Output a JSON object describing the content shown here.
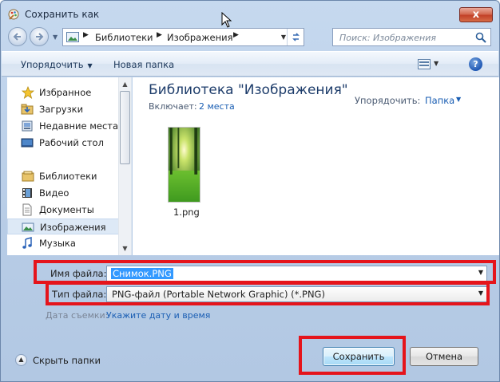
{
  "window": {
    "title": "Сохранить как",
    "close_glyph": "x"
  },
  "address": {
    "crumbs": [
      "Библиотеки",
      "Изображения"
    ],
    "search_placeholder": "Поиск: Изображения"
  },
  "toolbar": {
    "organize_label": "Упорядочить",
    "new_folder_label": "Новая папка",
    "help_glyph": "?"
  },
  "sidebar": {
    "items": [
      {
        "label": "Избранное",
        "icon": "star-icon"
      },
      {
        "label": "Загрузки",
        "icon": "downloads-icon"
      },
      {
        "label": "Недавние места",
        "icon": "recent-places-icon"
      },
      {
        "label": "Рабочий стол",
        "icon": "desktop-icon"
      },
      {
        "label": "Библиотеки",
        "icon": "libraries-icon"
      },
      {
        "label": "Видео",
        "icon": "video-icon"
      },
      {
        "label": "Документы",
        "icon": "documents-icon"
      },
      {
        "label": "Изображения",
        "icon": "pictures-icon",
        "selected": true
      },
      {
        "label": "Музыка",
        "icon": "music-icon"
      }
    ]
  },
  "content": {
    "library_title": "Библиотека \"Изображения\"",
    "includes_label": "Включает:",
    "includes_link": "2 места",
    "arrange_label": "Упорядочить:",
    "arrange_value": "Папка",
    "files": [
      {
        "name": "1.png"
      }
    ]
  },
  "form": {
    "filename_label": "Имя файла:",
    "filename_value": "Снимок.PNG",
    "filetype_label": "Тип файла:",
    "filetype_value": "PNG-файл (Portable Network Graphic) (*.PNG)",
    "date_label": "Дата съемки:",
    "date_link": "Укажите дату и время"
  },
  "footer": {
    "hide_folders_label": "Скрыть папки",
    "save_label": "Сохранить",
    "cancel_label": "Отмена"
  },
  "colors": {
    "highlight": "#e5141b",
    "link": "#1a5eb3",
    "selection": "#3399ff"
  }
}
